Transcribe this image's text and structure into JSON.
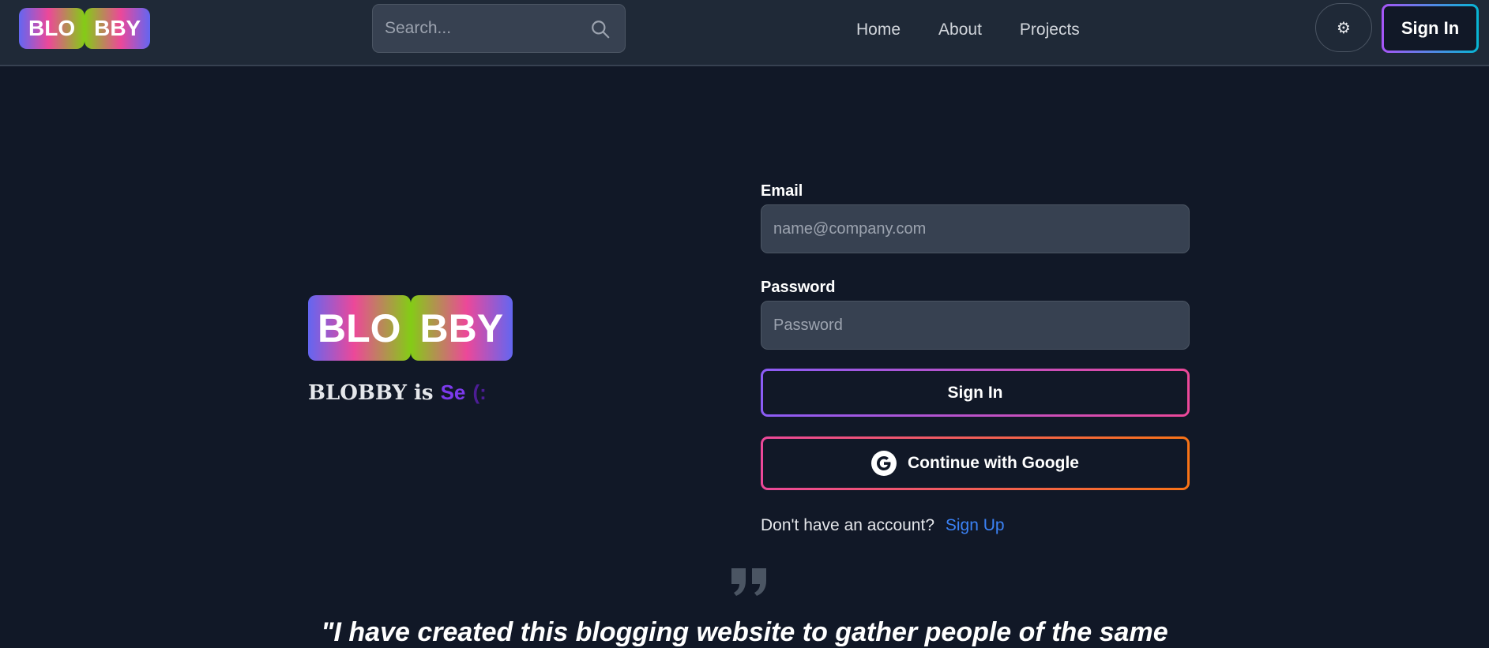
{
  "navbar": {
    "logo": {
      "part1": "BLO",
      "part2": "BBY"
    },
    "search": {
      "placeholder": "Search..."
    },
    "links": [
      "Home",
      "About",
      "Projects"
    ],
    "theme_toggle_icon": "gear-icon",
    "signin_label": "Sign In"
  },
  "hero": {
    "logo": {
      "part1": "BLO",
      "part2": "BBY"
    },
    "tagline_prefix": "BLOBBY is ",
    "tagline_typed": "Se",
    "tagline_cursor": "(:"
  },
  "form": {
    "email_label": "Email",
    "email_placeholder": "name@company.com",
    "password_label": "Password",
    "password_placeholder": "Password",
    "signin_label": "Sign In",
    "google_label": "Continue with Google",
    "no_account_text": "Don't have an account?",
    "signup_link": "Sign Up"
  },
  "quote": {
    "text": "\"I have created this blogging website to gather people of the same"
  },
  "colors": {
    "background": "#111827",
    "navbar": "#1f2937",
    "input": "#374151",
    "link": "#3b82f6",
    "accent_purple": "#7c3aed"
  }
}
